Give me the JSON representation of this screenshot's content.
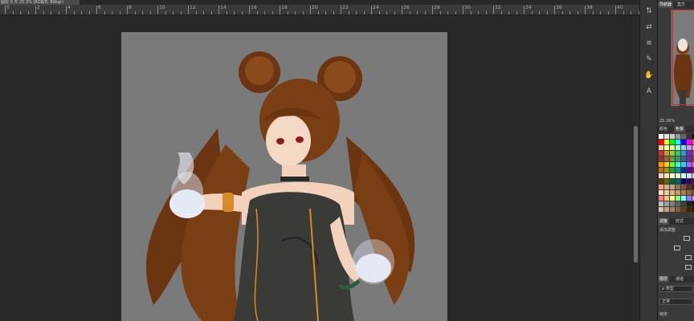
{
  "document": {
    "tab_title": "图层 0 ® 25.3% (RGB/8, 80bgr)"
  },
  "ruler": {
    "labels": [
      "0",
      "2",
      "4",
      "6",
      "8",
      "10",
      "12",
      "14",
      "16",
      "18",
      "20",
      "22",
      "24",
      "26",
      "28",
      "30",
      "32",
      "34",
      "36",
      "38",
      "40"
    ]
  },
  "tools": [
    "arrow-tool-icon",
    "swap-icon",
    "align-icon",
    "pen-icon",
    "hand-icon",
    "text-tool-icon"
  ],
  "panel": {
    "nav_tabs": [
      "导航器",
      "直方"
    ],
    "zoom": "25.26%",
    "color_tabs": [
      "颜色",
      "色板"
    ],
    "adjust_tabs": [
      "调整",
      "样式"
    ],
    "adjust_add_label": "添加调整",
    "layers_tabs": [
      "图层",
      "通道"
    ],
    "layer_kind": "ρ 类型",
    "blend_mode": "正常",
    "lock_label": "锁定:"
  },
  "swatch_colors": [
    "#ffffff",
    "#e6e6e6",
    "#cccccc",
    "#999999",
    "#666666",
    "#333333",
    "#000000",
    "#ff0000",
    "#ffff00",
    "#00ff00",
    "#00ffff",
    "#0000ff",
    "#ff00ff",
    "#ff6666",
    "#ffcc99",
    "#ffff99",
    "#ccff99",
    "#99ffcc",
    "#99ccff",
    "#cc99ff",
    "#ff99cc",
    "#cc3333",
    "#cc9933",
    "#99cc33",
    "#33cc66",
    "#3399cc",
    "#6633cc",
    "#cc3399",
    "#993333",
    "#996633",
    "#669933",
    "#339966",
    "#336699",
    "#663399",
    "#993366",
    "#ff9900",
    "#ffcc00",
    "#66ff33",
    "#33ffcc",
    "#33ccff",
    "#9966ff",
    "#ff66cc",
    "#cc6600",
    "#999900",
    "#339933",
    "#009999",
    "#003399",
    "#660099",
    "#990066",
    "#ffcccc",
    "#ffe5cc",
    "#ffffcc",
    "#e5ffcc",
    "#ccffff",
    "#cce5ff",
    "#e5ccff",
    "#663300",
    "#666600",
    "#006633",
    "#006666",
    "#000066",
    "#330066",
    "#660033",
    "#f2a679",
    "#d9b38c",
    "#bfa68c",
    "#8c7359",
    "#735940",
    "#4d3319",
    "#33190d",
    "#ffd9b3",
    "#f2cc99",
    "#e6b380",
    "#cc9966",
    "#b3804d",
    "#996633",
    "#804d1a",
    "#ff8080",
    "#ffbf80",
    "#ffff80",
    "#80ff80",
    "#80ffff",
    "#8080ff",
    "#ff80ff",
    "#c0c0c0",
    "#a0a0a0",
    "#808080",
    "#606060",
    "#404040",
    "#202020",
    "#101010",
    "#e0c0a0",
    "#c0a080",
    "#a08060",
    "#806040",
    "#604020",
    "#402000",
    "#201000"
  ]
}
